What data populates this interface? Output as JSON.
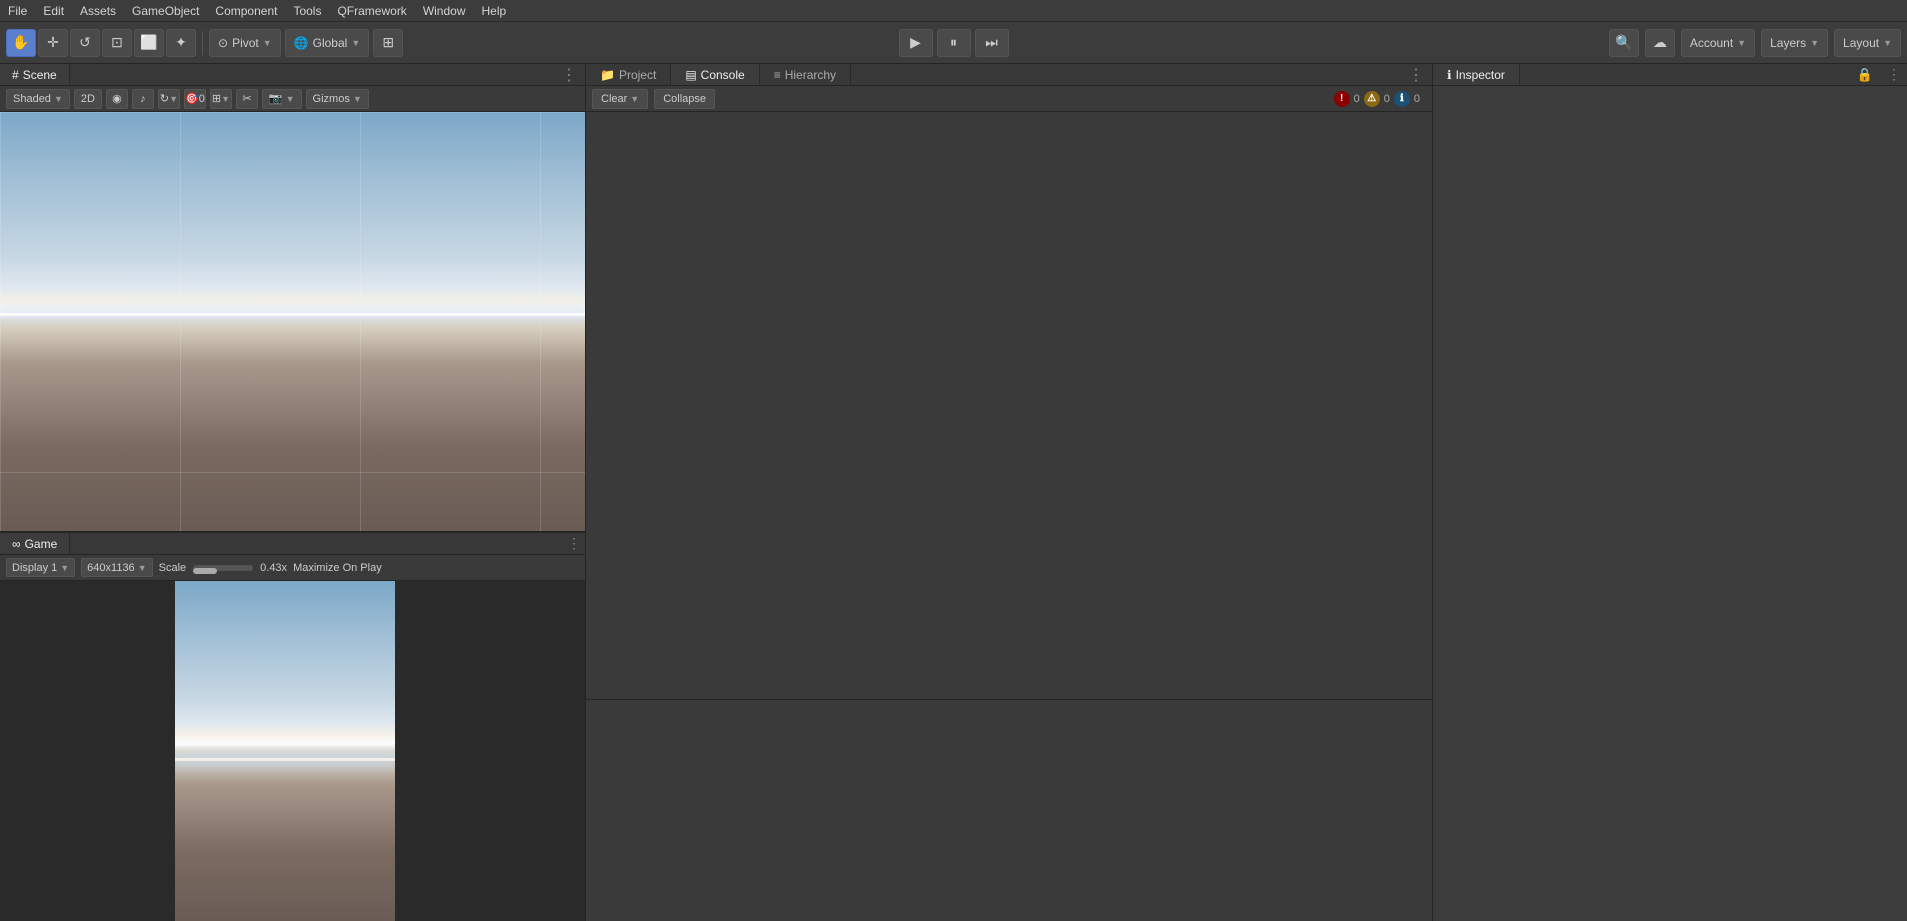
{
  "menuBar": {
    "items": [
      "File",
      "Edit",
      "Assets",
      "GameObject",
      "Component",
      "Tools",
      "QFramework",
      "Window",
      "Help"
    ]
  },
  "toolbar": {
    "tools": [
      {
        "name": "hand-tool",
        "icon": "✋"
      },
      {
        "name": "move-tool",
        "icon": "✛"
      },
      {
        "name": "rotate-tool",
        "icon": "↺"
      },
      {
        "name": "scale-tool",
        "icon": "⊡"
      },
      {
        "name": "rect-tool",
        "icon": "⬜"
      },
      {
        "name": "transform-tool",
        "icon": "✦"
      }
    ],
    "pivotLabel": "Pivot",
    "globalLabel": "Global",
    "gridIcon": "⊞",
    "playIcon": "▶",
    "pauseIcon": "⏸",
    "stepIcon": "⏭",
    "searchIcon": "🔍",
    "cloudIcon": "☁",
    "accountLabel": "Account",
    "layersLabel": "Layers",
    "layoutLabel": "Layout"
  },
  "scenePanel": {
    "tabLabel": "Scene",
    "tabIcon": "#",
    "shading": "Shaded",
    "viewMode": "2D",
    "toolbar": {
      "buttons": [
        "◉",
        "♪",
        "↻",
        "🎯",
        "⊞",
        "✂",
        "📷",
        "Gizmos"
      ]
    }
  },
  "gamePanel": {
    "tabLabel": "Game",
    "tabIcon": "∞",
    "display": "Display 1",
    "resolution": "640x1136",
    "scaleLabel": "Scale",
    "scaleValue": "0.43x",
    "maximizeLabel": "Maximize On Play"
  },
  "consolePanel": {
    "tabs": [
      "Project",
      "Console",
      "Hierarchy"
    ],
    "activeTab": "Console",
    "clearLabel": "Clear",
    "collapseLabel": "Collapse",
    "errorCount": "0",
    "warnCount": "0",
    "infoCount": "0"
  },
  "inspectorPanel": {
    "tabLabel": "Inspector",
    "tabIcon": "ℹ"
  }
}
